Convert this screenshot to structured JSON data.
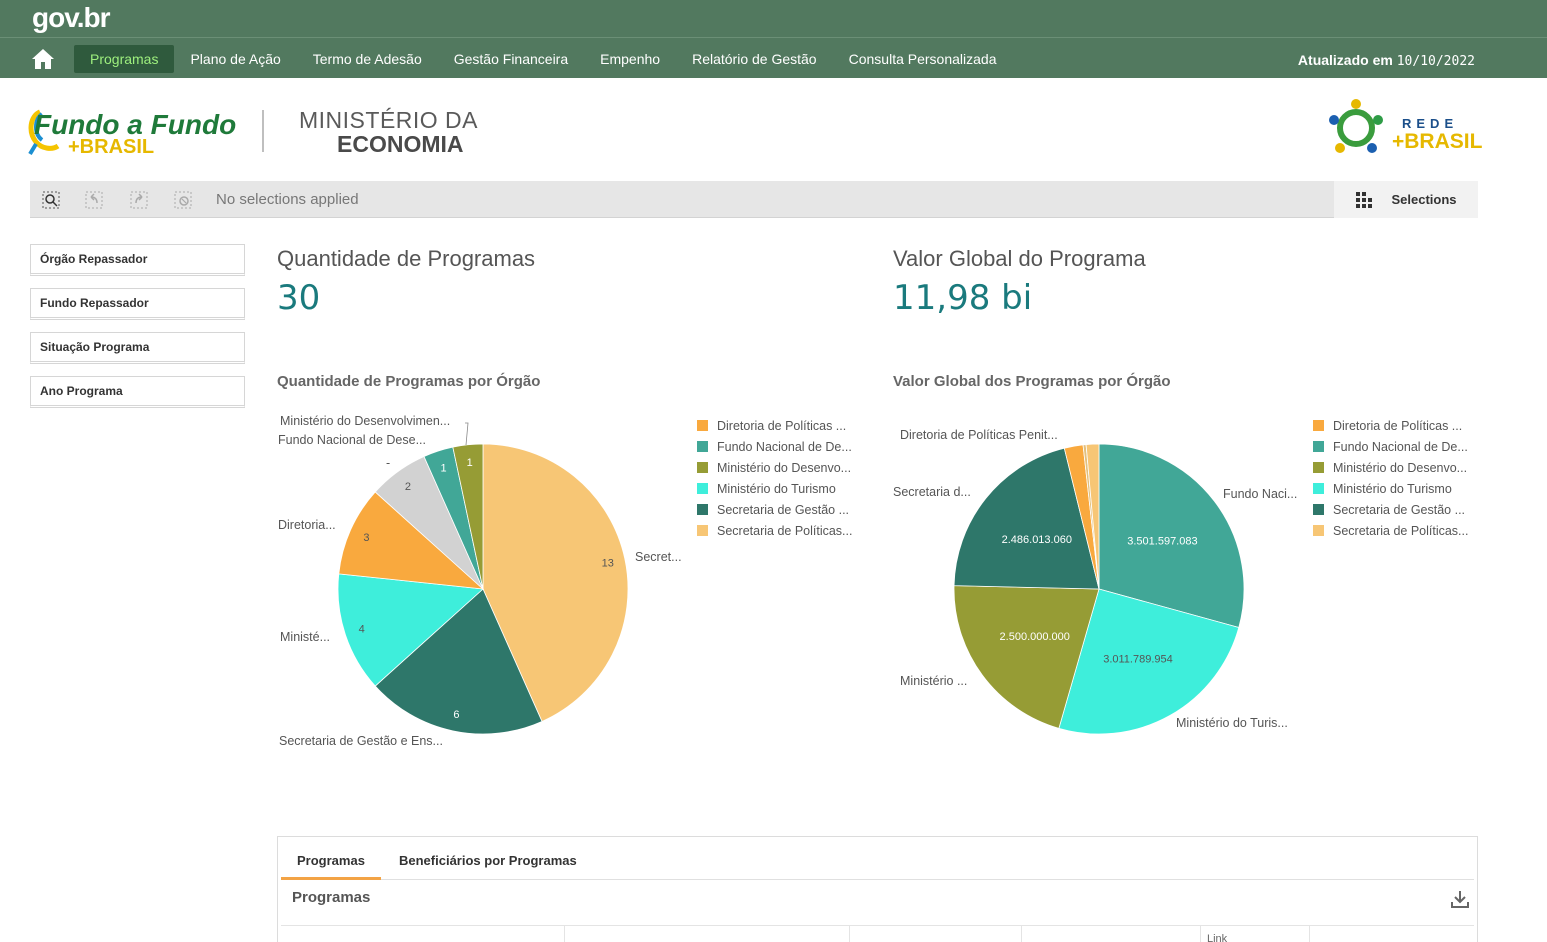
{
  "brand": {
    "govbr": "gov.br"
  },
  "nav": {
    "items": [
      {
        "label": "Programas",
        "active": true
      },
      {
        "label": "Plano de Ação",
        "active": false
      },
      {
        "label": "Termo de Adesão",
        "active": false
      },
      {
        "label": "Gestão Financeira",
        "active": false
      },
      {
        "label": "Empenho",
        "active": false
      },
      {
        "label": "Relatório de Gestão",
        "active": false
      },
      {
        "label": "Consulta Personalizada",
        "active": false
      }
    ],
    "updated_label": "Atualizado em",
    "updated_date": "10/10/2022"
  },
  "logos": {
    "fundo_line1": "Fundo a Fundo",
    "fundo_line2": "+BRASIL",
    "ministerio_line1": "MINISTÉRIO DA",
    "ministerio_line2": "ECONOMIA",
    "rede_line1": "REDE",
    "rede_line2": "+BRASIL"
  },
  "selection_bar": {
    "no_selections": "No selections applied",
    "selections_label": "Selections"
  },
  "filters": [
    "Órgão Repassador",
    "Fundo Repassador",
    "Situação Programa",
    "Ano Programa"
  ],
  "kpis": {
    "quantidade": {
      "title": "Quantidade de Programas",
      "value": "30"
    },
    "valor": {
      "title": "Valor Global do Programa",
      "value": "11,98 bi"
    }
  },
  "colors": {
    "Diretoria de Políticas": "#f9a93e",
    "Fundo Nacional": "#41a797",
    "Ministério do Desenvolvimento": "#969c35",
    "Ministério do Turismo": "#3eeedb",
    "Secretaria de Gestão": "#2e776a",
    "Secretaria de Políticas": "#f7c675",
    "Outros": "#d2d2d2"
  },
  "chart_data": [
    {
      "type": "pie",
      "title": "Quantidade de Programas por Órgão",
      "legend": [
        "Diretoria de Políticas ...",
        "Fundo Nacional de De...",
        "Ministério do Desenvo...",
        "Ministério do Turismo",
        "Secretaria de Gestão ...",
        "Secretaria de Políticas..."
      ],
      "slices": [
        {
          "label": "Secret...",
          "value": 13,
          "value_label": "13",
          "color": "#f7c675"
        },
        {
          "label": "Secretaria de Gestão e Ens...",
          "value": 6,
          "value_label": "6",
          "color": "#2e776a"
        },
        {
          "label": "Ministé...",
          "value": 4,
          "value_label": "4",
          "color": "#3eeedb"
        },
        {
          "label": "Diretoria...",
          "value": 3,
          "value_label": "3",
          "color": "#f9a93e"
        },
        {
          "label": "-",
          "value": 2,
          "value_label": "2",
          "color": "#d2d2d2"
        },
        {
          "label": "Fundo Nacional de Dese...",
          "value": 1,
          "value_label": "1",
          "color": "#41a797"
        },
        {
          "label": "Ministério do Desenvolvimen...",
          "value": 1,
          "value_label": "1",
          "color": "#969c35"
        }
      ]
    },
    {
      "type": "pie",
      "title": "Valor Global dos Programas por Órgão",
      "legend": [
        "Diretoria de Políticas ...",
        "Fundo Nacional de De...",
        "Ministério do Desenvo...",
        "Ministério do Turismo",
        "Secretaria de Gestão ...",
        "Secretaria de Políticas..."
      ],
      "slices": [
        {
          "label": "Fundo Naci...",
          "value": 3501597083,
          "value_label": "3.501.597.083",
          "color": "#41a797"
        },
        {
          "label": "Ministério do Turis...",
          "value": 3011789954,
          "value_label": "3.011.789.954",
          "color": "#3eeedb"
        },
        {
          "label": "Ministério ...",
          "value": 2500000000,
          "value_label": "2.500.000.000",
          "color": "#969c35"
        },
        {
          "label": "Secretaria d...",
          "value": 2486013060,
          "value_label": "2.486.013.060",
          "color": "#2e776a"
        },
        {
          "label": "Diretoria de Políticas Penit...",
          "value": 250000000,
          "value_label": "",
          "color": "#f9a93e"
        },
        {
          "label": "",
          "value": 40000000,
          "value_label": "",
          "color": "#e2c07e"
        },
        {
          "label": "",
          "value": 170000000,
          "value_label": "",
          "color": "#f7c675"
        }
      ]
    }
  ],
  "panel": {
    "tabs": [
      "Programas",
      "Beneficiários por Programas"
    ],
    "title": "Programas",
    "columns": [
      "Link"
    ]
  }
}
